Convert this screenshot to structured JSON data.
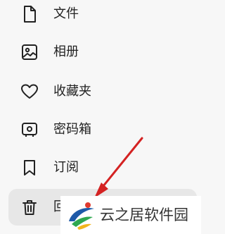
{
  "sidebar": {
    "items": [
      {
        "label": "文件",
        "icon": "file-icon"
      },
      {
        "label": "相册",
        "icon": "photo-icon"
      },
      {
        "label": "收藏夹",
        "icon": "heart-icon"
      },
      {
        "label": "密码箱",
        "icon": "safe-icon"
      },
      {
        "label": "订阅",
        "icon": "bookmark-icon"
      },
      {
        "label": "回",
        "icon": "trash-icon",
        "active": true
      }
    ]
  },
  "watermark": {
    "text": "云之居软件园",
    "icon": "watermark-logo-icon"
  },
  "colors": {
    "background": "#f7f7f7",
    "active_item": "#e7e7e7",
    "text": "#222222",
    "arrow": "#d42222"
  }
}
